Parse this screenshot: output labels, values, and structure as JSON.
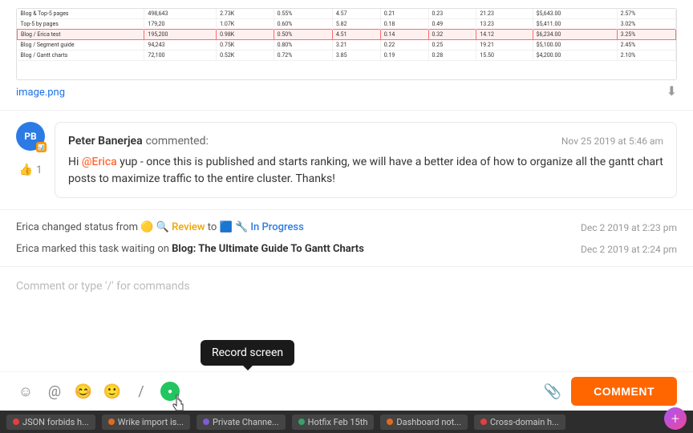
{
  "image": {
    "filename": "image.png",
    "rows": [
      [
        "Blog & Top-5 pages",
        "498,643",
        "2.73K",
        "0.55%",
        "4.57",
        "0.21",
        "0.23",
        "21.23",
        "$5,643.00",
        "2.57%"
      ],
      [
        "Top-5 by pages",
        "179,20",
        "1.07K",
        "0.60%",
        "5.82",
        "0.18",
        "0.49",
        "13.23",
        "$5,411.00",
        "3.02%"
      ],
      [
        "Blog / Erica test",
        "195,200",
        "0.98K",
        "0.50%",
        "4.51",
        "0.14",
        "0.32",
        "14.12",
        "$6,234.00",
        "3.25%"
      ],
      [
        "Blog / Segment guide",
        "94,243",
        "0.75K",
        "0.80%",
        "3.21",
        "0.22",
        "0.25",
        "19.21",
        "$5,100.00",
        "2.45%"
      ],
      [
        "Blog / Gantt charts",
        "72,100",
        "0.52K",
        "0.72%",
        "3.85",
        "0.19",
        "0.28",
        "15.50",
        "$4,200.00",
        "2.10%"
      ]
    ],
    "highlighted_row": 3
  },
  "comment": {
    "author": "Peter Banerjea",
    "action": "commented:",
    "time": "Nov 25 2019 at 5:46 am",
    "avatar_initials": "PB",
    "avatar_badge": "📊",
    "mention": "@Erica",
    "body_before": "Hi ",
    "body_after": " yup - once this is published and starts ranking, we will have a better idea of how to organize all the gantt chart posts to maximize traffic to the entire cluster. Thanks!",
    "likes": "1"
  },
  "activity": [
    {
      "text_before": "Erica changed status from",
      "from_status": "🟡 🔍 Review",
      "to": "to",
      "to_status": "🟦 🔧 In Progress",
      "time": "Dec 2 2019 at 2:23 pm"
    },
    {
      "text_before": "Erica marked this task waiting on",
      "task_link": "Blog: The Ultimate Guide To Gantt Charts",
      "time": "Dec 2 2019 at 2:24 pm"
    }
  ],
  "comment_input": {
    "placeholder": "Comment or type '/' for commands"
  },
  "toolbar": {
    "icons": [
      {
        "name": "emoji-people-icon",
        "symbol": "☺"
      },
      {
        "name": "mention-icon",
        "symbol": "@"
      },
      {
        "name": "emoji-smile-icon",
        "symbol": "😊"
      },
      {
        "name": "emoji-face-icon",
        "symbol": "🙂"
      },
      {
        "name": "slash-command-icon",
        "symbol": "/"
      },
      {
        "name": "record-screen-icon",
        "symbol": "●"
      }
    ],
    "record_tooltip": "Record screen",
    "comment_button": "COMMENT",
    "attachment_icon": "📎"
  },
  "taskbar": {
    "items": [
      {
        "label": "JSON forbids h...",
        "dot_color": "red"
      },
      {
        "label": "Wrike import is...",
        "dot_color": "orange"
      },
      {
        "label": "Private Channe...",
        "dot_color": "purple"
      },
      {
        "label": "Hotfix Feb 15th",
        "dot_color": "green"
      },
      {
        "label": "Dashboard not...",
        "dot_color": "orange"
      },
      {
        "label": "Cross-domain h...",
        "dot_color": "red"
      }
    ]
  },
  "fab": {
    "symbol": "+"
  }
}
